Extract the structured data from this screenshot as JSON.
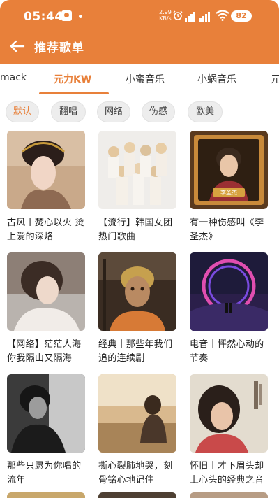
{
  "status_bar": {
    "time": "05:44",
    "net_speed_value": "2.99",
    "net_speed_unit": "KB/s",
    "battery": "82"
  },
  "app_bar": {
    "title": "推荐歌单"
  },
  "tabs": [
    {
      "label": "mack"
    },
    {
      "label": "元力KW"
    },
    {
      "label": "小蜜音乐"
    },
    {
      "label": "小蜗音乐"
    },
    {
      "label": "元"
    }
  ],
  "active_tab": "元力KW",
  "filters": [
    {
      "label": "默认"
    },
    {
      "label": "翻唱"
    },
    {
      "label": "网络"
    },
    {
      "label": "伤感"
    },
    {
      "label": "欧美"
    }
  ],
  "playlists": [
    {
      "title": "古风丨焚心以火 烫上爱的深烙"
    },
    {
      "title": "【流行】韩国女团热门歌曲"
    },
    {
      "title": "有一种伤感叫《李圣杰》",
      "cover_caption": "李圣杰"
    },
    {
      "title": "【网络】茫茫人海你我隔山又隔海"
    },
    {
      "title": "经典丨那些年我们追的连续剧"
    },
    {
      "title": "电音丨怦然心动的节奏"
    },
    {
      "title": "那些只愿为你唱的流年"
    },
    {
      "title": "撕心裂肺地哭，刻骨铭心地记住"
    },
    {
      "title": "怀旧丨才下眉头却上心头的经典之音"
    }
  ],
  "colors": {
    "accent": "#E8803A"
  }
}
